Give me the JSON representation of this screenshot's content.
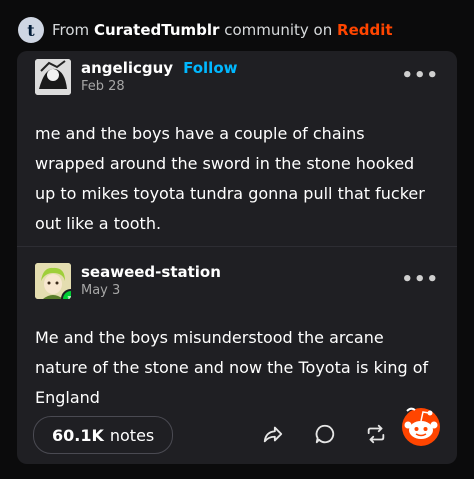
{
  "source": {
    "prefix": "From",
    "community": "CuratedTumblr",
    "middle": "community on",
    "platform": "Reddit",
    "logo_letter": "t",
    "colors": {
      "platform": "#ff4500",
      "community": "#ffffff"
    }
  },
  "posts": [
    {
      "username": "angelicguy",
      "follow_label": "Follow",
      "date": "Feb 28",
      "menu": "•••",
      "body": "me and the boys have a couple of chains wrapped around the sword in the stone hooked up to mikes toyota tundra gonna pull that fucker out like a tooth."
    },
    {
      "username": "seaweed-station",
      "date": "May 3",
      "menu": "•••",
      "badge_icon": "reblog-icon",
      "body": "Me and the boys misunderstood the arcane nature of the stone and now the Toyota is king of England"
    }
  ],
  "footer": {
    "notes_count": "60.1K",
    "notes_label": "notes",
    "actions": [
      "share-icon",
      "comment-icon",
      "reblog-icon",
      "like-icon"
    ]
  },
  "colors": {
    "background": "#0b0b0c",
    "card": "#1f1f23",
    "follow": "#00b8ff",
    "reblog_badge": "#00cf35",
    "reddit": "#ff4500"
  }
}
